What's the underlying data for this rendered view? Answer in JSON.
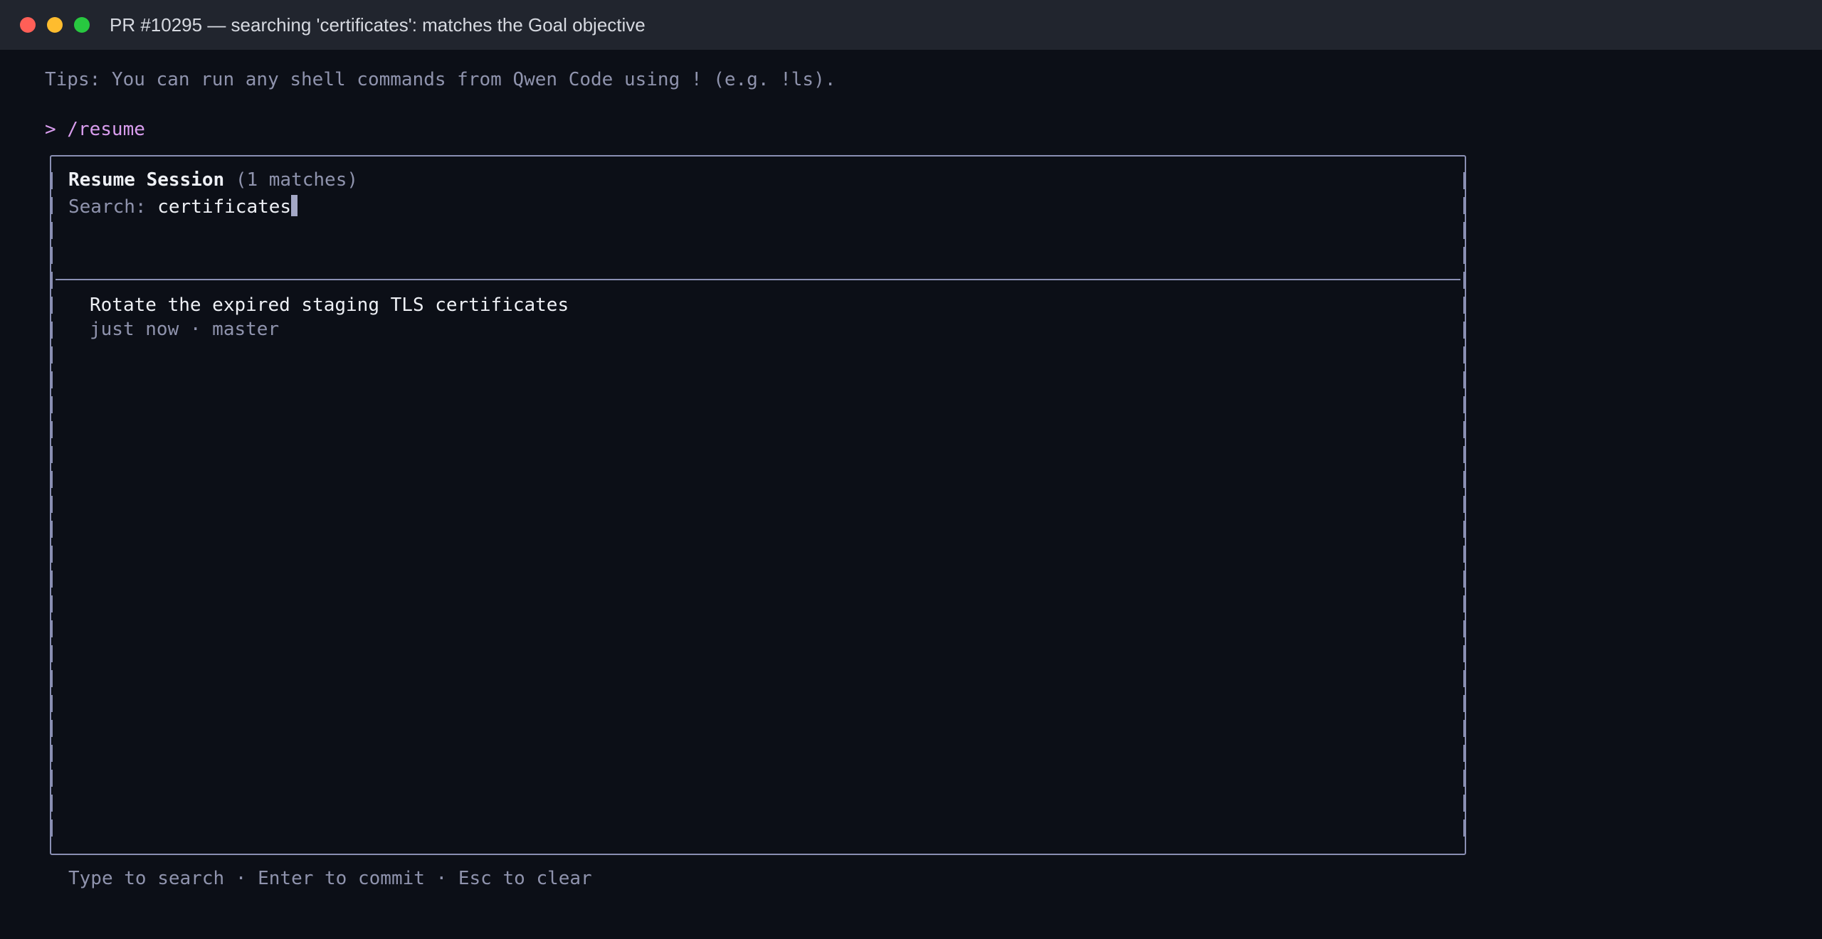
{
  "window": {
    "title": "PR #10295 — searching 'certificates': matches the Goal objective"
  },
  "terminal": {
    "tips": "Tips: You can run any shell commands from Qwen Code using ! (e.g. !ls).",
    "prompt": "> /resume"
  },
  "resume_dialog": {
    "title": "Resume Session",
    "match_count": "(1 matches)",
    "search_label": "Search:",
    "search_value": "certificates",
    "results": [
      {
        "title": "Rotate the expired staging TLS certificates",
        "meta": "just now · master"
      }
    ],
    "footer_hint": "Type to search · Enter to commit · Esc to clear"
  },
  "colors": {
    "background": "#0c0f17",
    "titlebar": "#21252e",
    "muted_text": "#8f93ad",
    "prompt_accent": "#d99dee",
    "border": "#8a8fb3"
  },
  "icons": [
    "close-dot",
    "minimize-dot",
    "maximize-dot"
  ]
}
